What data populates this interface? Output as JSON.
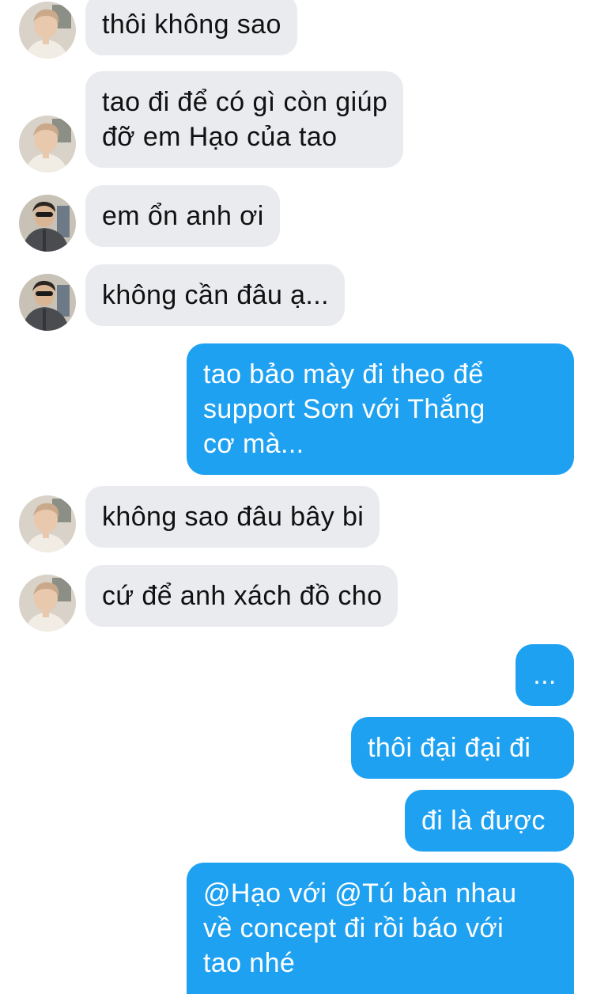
{
  "messages": [
    {
      "text": "thôi không sao",
      "lines": [
        "thôi không sao"
      ],
      "sender": "friend-a"
    },
    {
      "lines": [
        "tao đi để có gì còn giúp",
        "đỡ em Hạo của tao"
      ],
      "sender": "friend-a"
    },
    {
      "text": "em ổn anh ơi",
      "lines": [
        "em ổn anh ơi"
      ],
      "sender": "friend-b"
    },
    {
      "text": "không cần đâu ạ...",
      "lines": [
        "không cần đâu ạ..."
      ],
      "sender": "friend-b"
    },
    {
      "lines": [
        "tao bảo mày đi theo để",
        "support Sơn với Thắng",
        "cơ mà..."
      ],
      "sender": "me"
    },
    {
      "text": "không sao đâu bây bi",
      "lines": [
        "không sao đâu bây bi"
      ],
      "sender": "friend-a"
    },
    {
      "text": "cứ để anh xách đồ cho",
      "lines": [
        "cứ để anh xách đồ cho"
      ],
      "sender": "friend-a"
    },
    {
      "text": "...",
      "lines": [
        "..."
      ],
      "sender": "me"
    },
    {
      "text": "thôi đại đại đi",
      "lines": [
        "thôi đại đại đi"
      ],
      "sender": "me"
    },
    {
      "text": "đi là được",
      "lines": [
        "đi là được"
      ],
      "sender": "me"
    },
    {
      "lines": [
        "@Hạo với @Tú bàn nhau",
        "về concept đi rồi báo với",
        "tao nhé"
      ],
      "sender": "me"
    }
  ],
  "colors": {
    "incoming_bubble": "#e9ebef",
    "outgoing_bubble": "#1fa1f1",
    "incoming_text": "#111111",
    "outgoing_text": "#ffffff"
  },
  "icons": {
    "friend_a_avatar": "avatar-photo",
    "friend_b_avatar": "avatar-photo"
  }
}
